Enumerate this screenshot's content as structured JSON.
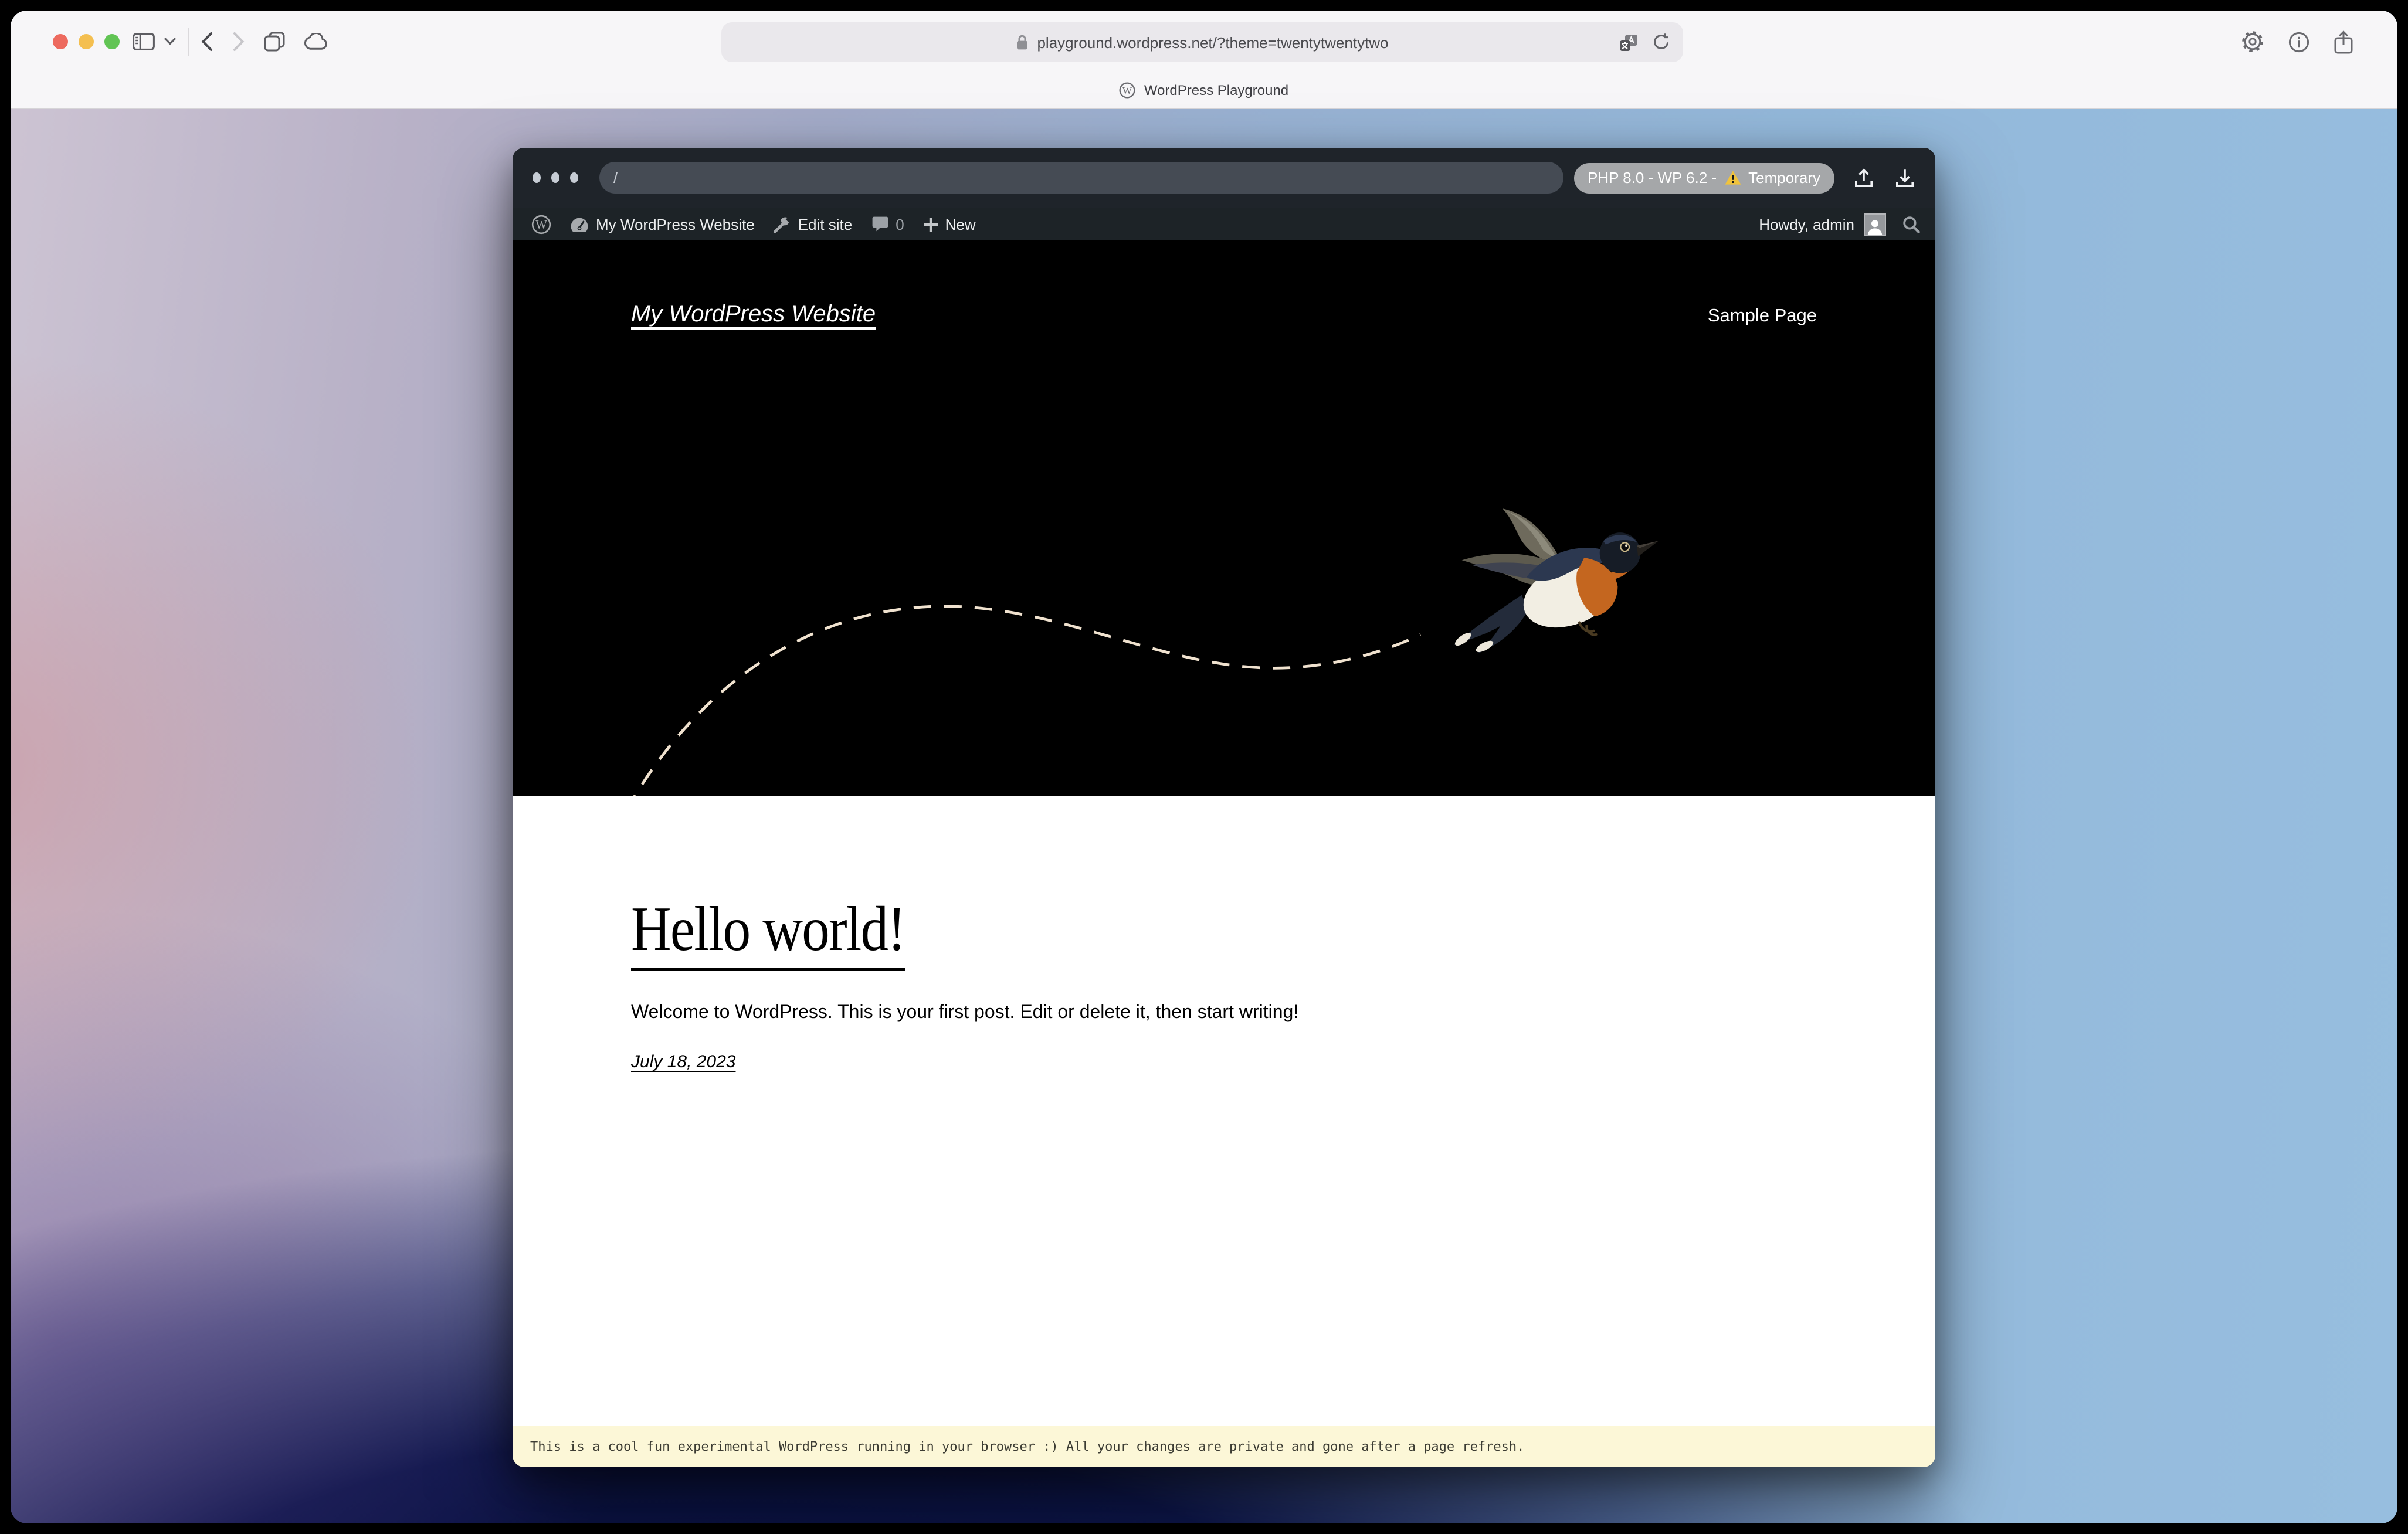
{
  "browser": {
    "url": "playground.wordpress.net/?theme=twentytwentytwo",
    "tab_title": "WordPress Playground"
  },
  "playground_bar": {
    "address": "/",
    "badge_prefix": "PHP 8.0 - WP 6.2 -",
    "badge_warning_label": "Temporary"
  },
  "admin_bar": {
    "site_name": "My WordPress Website",
    "edit_site": "Edit site",
    "comment_count": "0",
    "new_label": "New",
    "howdy": "Howdy, admin"
  },
  "site": {
    "title": "My WordPress Website",
    "nav": [
      {
        "label": "Sample Page"
      }
    ],
    "post_title": "Hello world!",
    "post_body": "Welcome to WordPress. This is your first post. Edit or delete it, then start writing!",
    "post_date": "July 18, 2023"
  },
  "notice": {
    "text": "This is a cool fun experimental WordPress running in your browser :) All your changes are private and gone after a page refresh."
  },
  "colors": {
    "warning_yellow": "#f0c33c",
    "notice_bg": "#fcf7d7",
    "admin_bar_bg": "#1d2327",
    "playground_bar_bg": "#1f242a",
    "site_header_bg": "#000000",
    "flight_path": "#f0e2cf",
    "traffic_red": "#ed6a5f",
    "traffic_yellow": "#f4bf50",
    "traffic_green": "#61c454"
  },
  "icons": {
    "left_toolbar": [
      "sidebar-icon",
      "chevron-down-icon",
      "back-icon",
      "forward-icon",
      "tabs-overview-icon",
      "cloud-icon"
    ],
    "urlbar": [
      "lock-icon",
      "translate-icon",
      "reload-icon"
    ],
    "right_toolbar": [
      "gear-icon",
      "info-icon",
      "share-icon"
    ],
    "playground": [
      "warning-icon",
      "upload-icon",
      "download-icon"
    ],
    "admin_bar": [
      "wordpress-logo-icon",
      "dashboard-gauge-icon",
      "tools-icon",
      "comment-icon",
      "plus-icon",
      "avatar",
      "search-icon"
    ]
  }
}
